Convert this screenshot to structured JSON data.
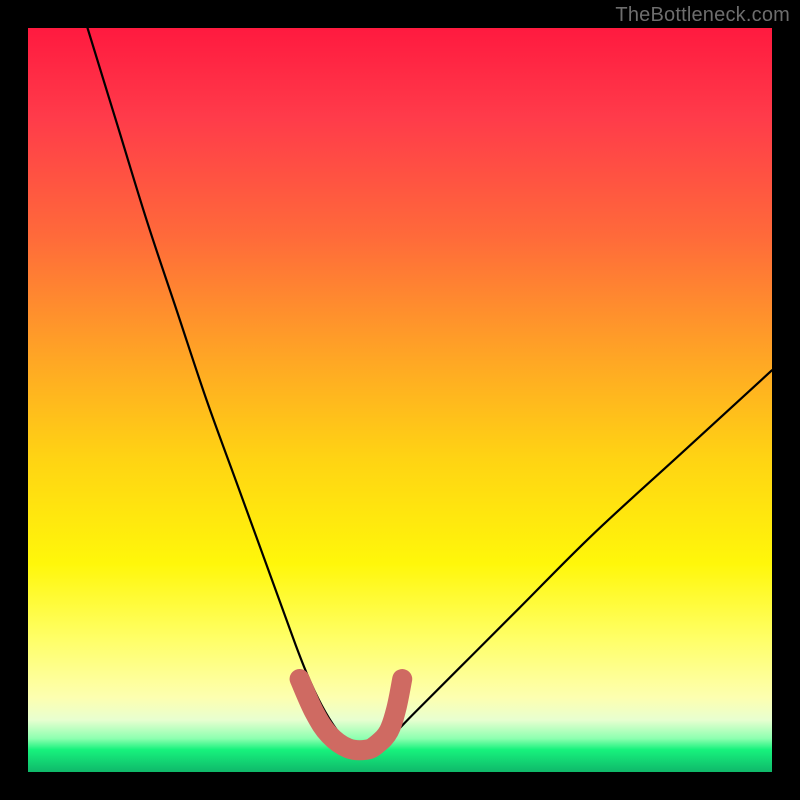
{
  "watermark": {
    "text": "TheBottleneck.com"
  },
  "chart_data": {
    "type": "line",
    "title": "",
    "xlabel": "",
    "ylabel": "",
    "xlim": [
      0,
      100
    ],
    "ylim": [
      0,
      100
    ],
    "series": [
      {
        "name": "bottleneck-curve",
        "x": [
          8,
          12,
          16,
          20,
          24,
          28,
          32,
          36,
          38,
          40,
          42,
          44,
          46,
          48,
          52,
          58,
          66,
          76,
          88,
          100
        ],
        "values": [
          100,
          87,
          74,
          62,
          50,
          39,
          28,
          17,
          12,
          8,
          5,
          3,
          3,
          4,
          8,
          14,
          22,
          32,
          43,
          54
        ]
      }
    ],
    "annotations": [
      {
        "name": "valley-marker",
        "type": "rounded-segment",
        "points_x": [
          36.5,
          38.5,
          40.5,
          43,
          45.5,
          47,
          48.5,
          49.5,
          50.3
        ],
        "points_y": [
          12.5,
          8.0,
          5.0,
          3.2,
          3.0,
          3.8,
          5.5,
          8.5,
          12.5
        ],
        "color": "#cf6a62"
      }
    ],
    "background": {
      "type": "vertical-gradient",
      "stops": [
        {
          "pos": 0.0,
          "color": "#ff1a3f"
        },
        {
          "pos": 0.45,
          "color": "#ffa824"
        },
        {
          "pos": 0.72,
          "color": "#fff70a"
        },
        {
          "pos": 0.93,
          "color": "#e8ffd0"
        },
        {
          "pos": 1.0,
          "color": "#0fb86a"
        }
      ]
    }
  }
}
